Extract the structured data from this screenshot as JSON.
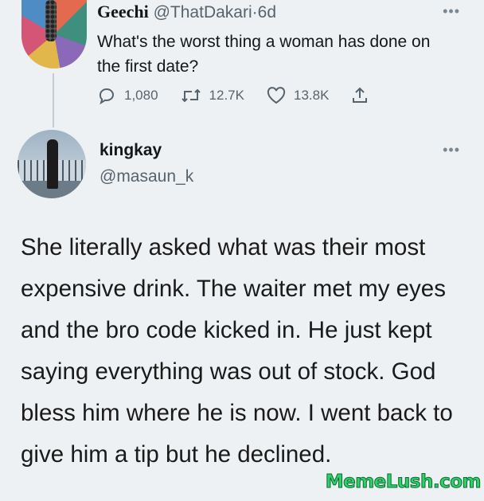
{
  "original_tweet": {
    "display_name": "Geechi",
    "handle": "@ThatDakari",
    "separator": "·",
    "age": "6d",
    "text": "What's the worst thing a woman has done on the first date?",
    "replies": "1,080",
    "retweets": "12.7K",
    "likes": "13.8K",
    "more_icon": "more-dots-icon",
    "icons": [
      "reply-icon",
      "retweet-icon",
      "like-icon",
      "share-icon"
    ]
  },
  "reply_tweet": {
    "display_name": "kingkay",
    "handle": "@masaun_k",
    "text": "She literally asked what was their most expensive drink. The waiter met my eyes and the bro code kicked in. He just kept saying everything was out of stock. God bless him where he is now. I went back to give him a tip but he declined.",
    "more_icon": "more-dots-icon"
  },
  "watermark": "MemeLush.com",
  "colors": {
    "background": "#eef1f3",
    "text": "#14171a",
    "secondary_text": "#57636c",
    "watermark": "#2fd06b"
  }
}
